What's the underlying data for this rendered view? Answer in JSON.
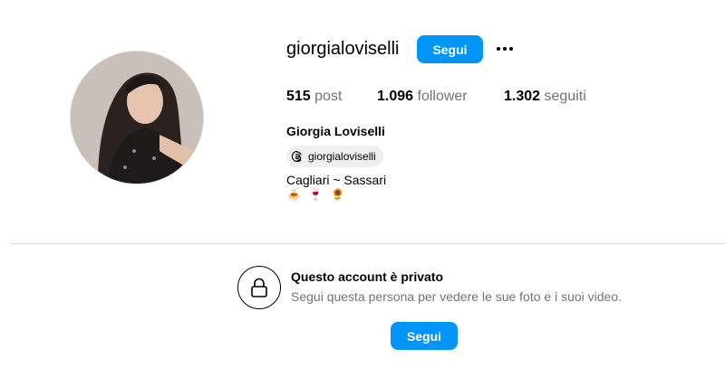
{
  "profile": {
    "username": "giorgialoviselli",
    "full_name": "Giorgia Loviselli",
    "follow_label": "Segui",
    "more_icon": "more-options-icon",
    "stats": {
      "posts_count": "515",
      "posts_label": "post",
      "followers_count": "1.096",
      "followers_label": "follower",
      "following_count": "1.302",
      "following_label": "seguiti"
    },
    "threads_handle": "giorgialoviselli",
    "threads_icon": "threads-icon",
    "bio_line": "Cagliari ~ Sassari",
    "bio_emojis": [
      "🍝",
      "🍷",
      "🌻"
    ]
  },
  "private_notice": {
    "title": "Questo account è privato",
    "description": "Segui questa persona per vedere le sue foto e i suoi video.",
    "follow_label": "Segui",
    "icon": "lock-icon"
  },
  "colors": {
    "accent": "#0095f6",
    "secondary_text": "#737373",
    "divider": "#dbdbdb",
    "chip_bg": "#efefef"
  }
}
